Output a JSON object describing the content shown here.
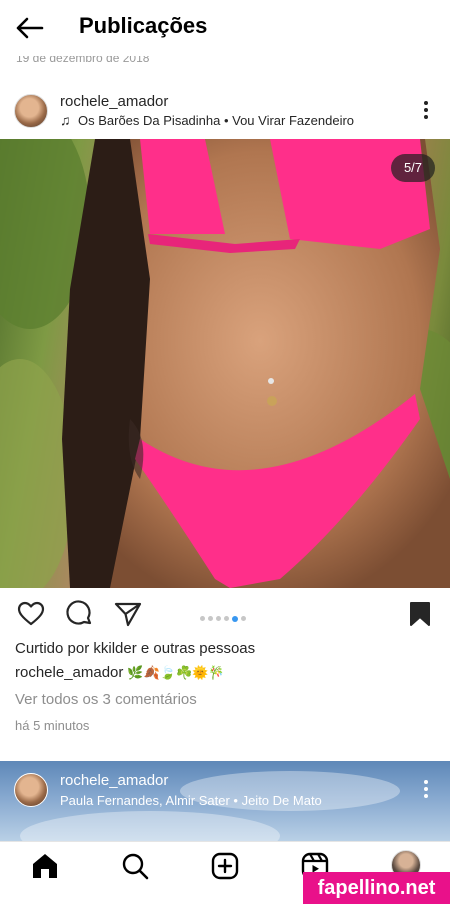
{
  "header": {
    "title": "Publicações",
    "back_icon": "arrow-left-icon"
  },
  "previous_post": {
    "date": "19 de dezembro de 2018"
  },
  "post": {
    "username": "rochele_amador",
    "music": "Os Barões Da Pisadinha • Vou Virar Fazendeiro",
    "music_icon": "music-note-icon",
    "more_icon": "more-vertical-icon",
    "media_counter": "5/7",
    "carousel": {
      "total": 7,
      "shown_dots": 6,
      "active_dot": 5
    },
    "actions": [
      "heart-icon",
      "comment-icon",
      "share-icon",
      "bookmark-icon"
    ],
    "liked_prefix": "Curtido por",
    "liked_user": "kkilder",
    "liked_suffix": "e",
    "liked_others": "outras pessoas",
    "caption_user": "rochele_amador",
    "caption_emojis": "🌿🍂🍃☘️🌞🎋",
    "view_comments": "Ver todos os 3 comentários",
    "time_ago": "há 5 minutos"
  },
  "next_post": {
    "username": "rochele_amador",
    "music": "Paula Fernandes, Almir Sater • Jeito De Mato"
  },
  "bottom_nav": {
    "items": [
      "home-icon",
      "search-icon",
      "create-icon",
      "reels-icon",
      "profile-avatar"
    ]
  },
  "watermark": "fapellino.net",
  "colors": {
    "accent_blue": "#3897f0",
    "bikini_pink": "#ff2f8a",
    "watermark_bg": "#e9118a"
  }
}
